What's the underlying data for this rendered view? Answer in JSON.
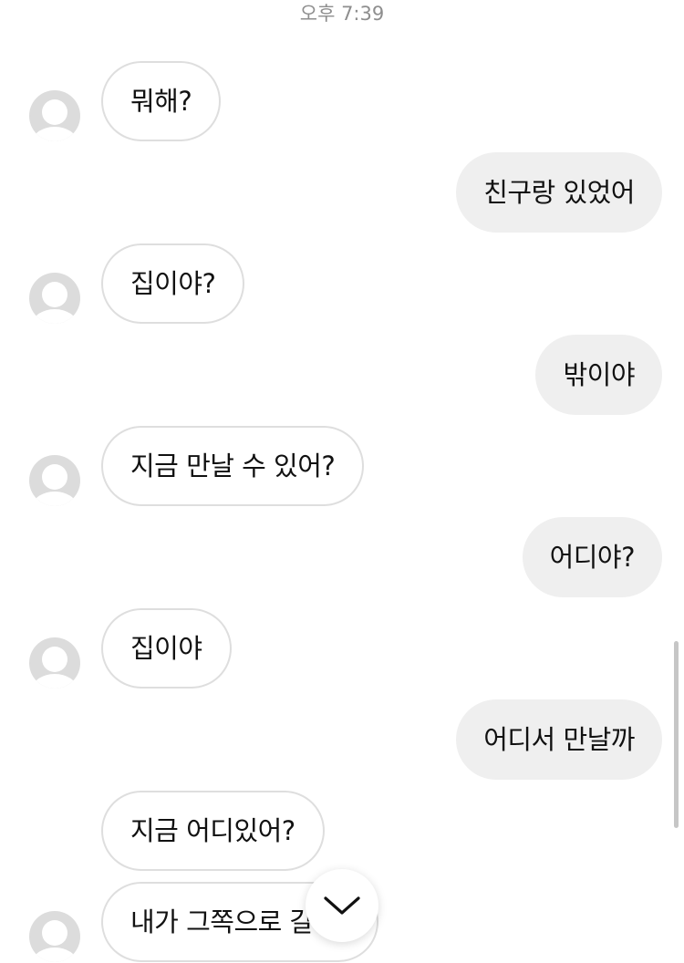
{
  "timestamp": "오후 7:39",
  "messages": [
    {
      "side": "in",
      "text": "뭐해?",
      "avatar": true
    },
    {
      "side": "out",
      "text": "친구랑 있었어"
    },
    {
      "side": "in",
      "text": "집이야?",
      "avatar": true
    },
    {
      "side": "out",
      "text": "밖이야"
    },
    {
      "side": "in",
      "text": "지금 만날 수 있어?",
      "avatar": true
    },
    {
      "side": "out",
      "text": "어디야?"
    },
    {
      "side": "in",
      "text": "집이야",
      "avatar": true
    },
    {
      "side": "out",
      "text": "어디서 만날까"
    },
    {
      "side": "in",
      "text": "지금 어디있어?",
      "avatar": false
    },
    {
      "side": "in",
      "text": "내가 그쪽으로 갈",
      "avatar": true
    }
  ],
  "icons": {
    "avatar": "person-placeholder-icon",
    "scroll_down": "chevron-down-icon"
  },
  "colors": {
    "background": "#ffffff",
    "incoming_bubble": "#ffffff",
    "incoming_border": "#dedede",
    "outgoing_bubble": "#efefef",
    "avatar": "#dcdcdc",
    "timestamp": "#8e8e8e"
  }
}
